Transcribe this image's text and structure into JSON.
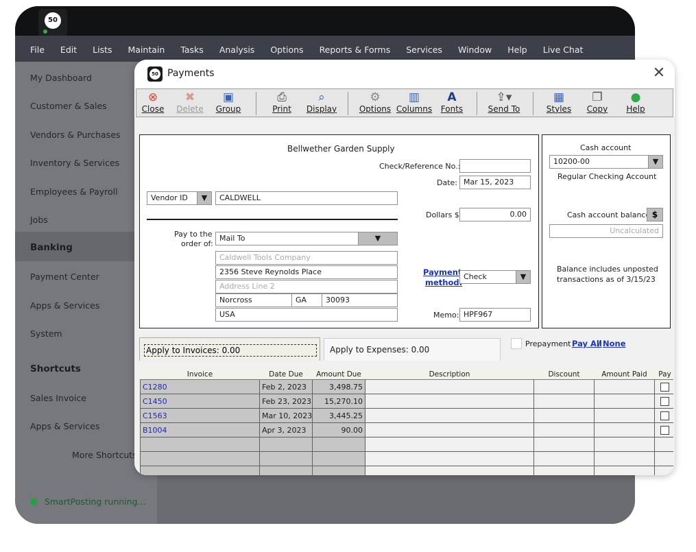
{
  "app": {
    "logo_text": "50",
    "menu": [
      "File",
      "Edit",
      "Lists",
      "Maintain",
      "Tasks",
      "Analysis",
      "Options",
      "Reports & Forms",
      "Services",
      "Window",
      "Help",
      "Live Chat"
    ]
  },
  "sidebar": {
    "items": [
      "My Dashboard",
      "Customer & Sales",
      "Vendors & Purchases",
      "Inventory & Services",
      "Employees & Payroll",
      "Jobs"
    ],
    "banking": "Banking",
    "banking_items": [
      "Payment Center",
      "Apps & Services",
      "System"
    ],
    "shortcuts_head": "Shortcuts",
    "shortcut_items": [
      "Sales Invoice",
      "Apps & Services"
    ],
    "more_shortcuts": "More Shortcuts",
    "status": "SmartPosting running..."
  },
  "dialog": {
    "logo_text": "50",
    "title": "Payments",
    "toolbar": {
      "close": "Close",
      "delete": "Delete",
      "group": "Group",
      "print": "Print",
      "display": "Display",
      "options": "Options",
      "columns": "Columns",
      "fonts": "Fonts",
      "send_to": "Send To",
      "styles": "Styles",
      "copy": "Copy",
      "help": "Help"
    },
    "company": "Bellwether Garden Supply",
    "check_ref_label": "Check/Reference No.:",
    "check_ref_value": "",
    "date_label": "Date:",
    "date_value": "Mar 15, 2023",
    "vendor_id_label": "Vendor ID",
    "vendor_id_value": "CALDWELL",
    "dollars_label": "Dollars $",
    "dollars_value": "0.00",
    "pay_to_label_1": "Pay to the",
    "pay_to_label_2": "order of:",
    "mail_to": "Mail To",
    "address": {
      "name_placeholder": "Caldwell Tools Company",
      "line1": "2356 Steve Reynolds Place",
      "line2_placeholder": "Address Line 2",
      "city": "Norcross",
      "state": "GA",
      "zip": "30093",
      "country": "USA"
    },
    "payment_method_label_1": "Payment",
    "payment_method_label_2": "method:",
    "payment_method_value": "Check",
    "memo_label": "Memo:",
    "memo_value": "HPF967",
    "cash_account_label": "Cash account",
    "cash_account_value": "10200-00",
    "cash_account_name": "Regular Checking Account",
    "cash_balance_label": "Cash account balance",
    "cash_balance_btn": "$",
    "cash_balance_placeholder": "Uncalculated",
    "balance_note_1": "Balance includes unposted",
    "balance_note_2": "transactions as of 3/15/23",
    "tab_invoices": "Apply to Invoices: 0.00",
    "tab_expenses": "Apply to Expenses: 0.00",
    "prepayment_label": "Prepayment",
    "pay_all": "Pay All",
    "slash": "/",
    "none": "None",
    "columns": [
      "Invoice",
      "Date Due",
      "Amount Due",
      "Description",
      "Discount",
      "Amount Paid",
      "Pay"
    ],
    "rows": [
      {
        "invoice": "C1280",
        "date_due": "Feb 2, 2023",
        "amount_due": "3,498.75",
        "description": "",
        "discount": "",
        "amount_paid": "",
        "pay": false
      },
      {
        "invoice": "C1450",
        "date_due": "Feb 23, 2023",
        "amount_due": "15,270.10",
        "description": "",
        "discount": "",
        "amount_paid": "",
        "pay": false
      },
      {
        "invoice": "C1563",
        "date_due": "Mar 10, 2023",
        "amount_due": "3,445.25",
        "description": "",
        "discount": "",
        "amount_paid": "",
        "pay": false
      },
      {
        "invoice": "B1004",
        "date_due": "Apr 3, 2023",
        "amount_due": "90.00",
        "description": "",
        "discount": "",
        "amount_paid": "",
        "pay": false
      }
    ],
    "empty_rows": 3
  }
}
